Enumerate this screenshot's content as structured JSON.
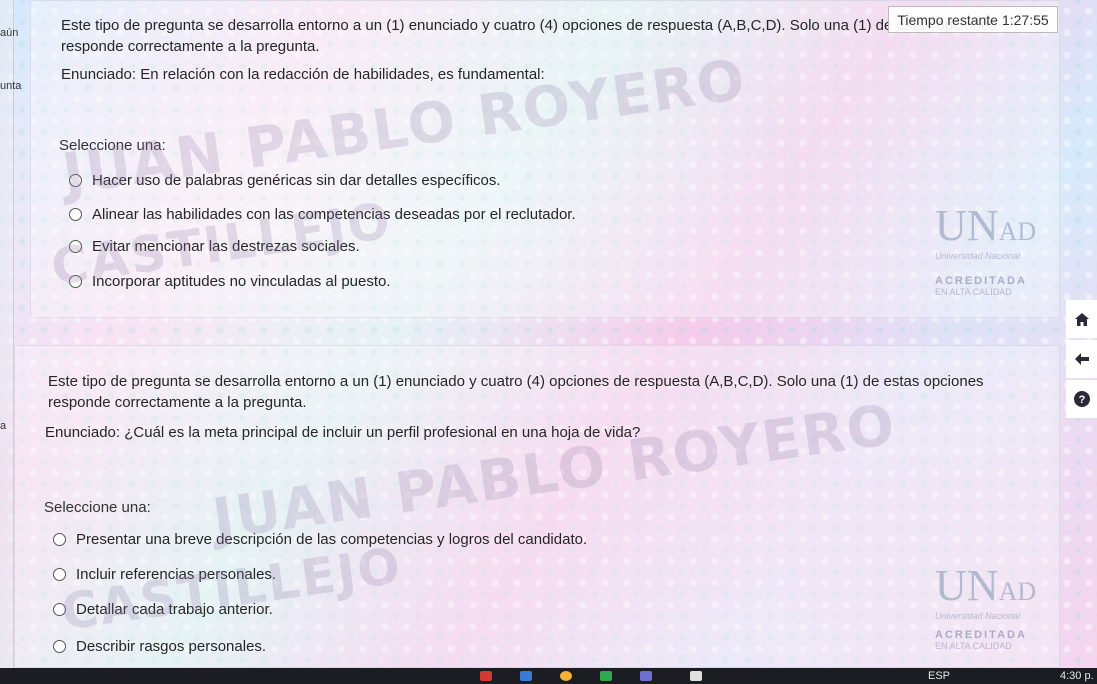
{
  "timer": {
    "label": "Tiempo restante",
    "value": "1:27:55"
  },
  "left_edge": {
    "label1": "aún",
    "label2": "unta",
    "label3": "a"
  },
  "q1": {
    "intro": "Este tipo de pregunta se desarrolla entorno a un (1) enunciado y cuatro (4) opciones de respuesta (A,B,C,D). Solo una (1) de estas opciones responde correctamente a la pregunta.",
    "statement": "Enunciado: En relación con la redacción de habilidades, es fundamental:",
    "select_label": "Seleccione una:",
    "options": [
      "Hacer uso de palabras genéricas sin dar detalles específicos.",
      "Alinear las habilidades con las competencias deseadas por el reclutador.",
      "Evitar mencionar las destrezas sociales.",
      "Incorporar aptitudes no vinculadas al puesto."
    ]
  },
  "q2": {
    "intro": "Este tipo de pregunta se desarrolla entorno a un (1) enunciado y cuatro (4) opciones de respuesta (A,B,C,D). Solo una (1) de estas opciones responde correctamente a la pregunta.",
    "statement": "Enunciado: ¿Cuál es la meta principal de incluir un perfil profesional en una hoja de vida?",
    "select_label": "Seleccione una:",
    "options": [
      "Presentar una breve descripción de las competencias y logros del candidato.",
      "Incluir referencias personales.",
      "Detallar cada trabajo anterior.",
      "Describir rasgos personales."
    ]
  },
  "watermark": {
    "line1": "JUAN PABLO ROYERO",
    "line2": "CASTILLEJO"
  },
  "logo": {
    "mark": "UN",
    "mark_small": "AD",
    "university": "Universidad Nacional",
    "accredited": "ACREDITADA",
    "quality": "EN ALTA CALIDAD"
  },
  "side_tools": {
    "home_icon": "home-icon",
    "back_icon": "arrow-left-icon",
    "help_icon": "help-icon"
  },
  "taskbar": {
    "language": "ESP",
    "time": "4:30 p."
  }
}
